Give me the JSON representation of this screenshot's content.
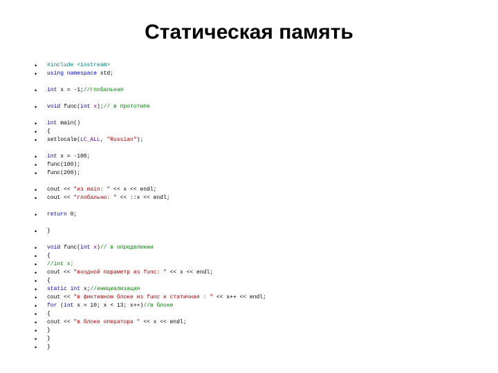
{
  "title": "Статическая память",
  "code": {
    "l1_pp": "#include ",
    "l1_inc": "<iostream>",
    "l2_a": "using namespace ",
    "l2_b": "std;",
    "l3_a": "int ",
    "l3_b": "x = -1;",
    "l3_c": "//глобальная",
    "l4_a": "void ",
    "l4_b": "func(",
    "l4_c": "int ",
    "l4_d": "x",
    "l4_e": ");",
    "l4_f": "// в прототипе",
    "l5_a": "int ",
    "l5_b": "main()",
    "l6": "{",
    "l7_a": "setlocale(",
    "l7_b": "LC_ALL",
    "l7_c": ", ",
    "l7_d": "\"Russian\"",
    "l7_e": ");",
    "l8_a": "int ",
    "l8_b": "x = -100;",
    "l9": "func(100);",
    "l10": "func(200);",
    "l11_a": "cout << ",
    "l11_b": "\"из main: \"",
    "l11_c": " << x << endl;",
    "l12_a": "cout << ",
    "l12_b": "\"глобально: \"",
    "l12_c": " << ::x << endl;",
    "l13_a": "return ",
    "l13_b": "0;",
    "l14": "}",
    "l15_a": "void ",
    "l15_b": "func(",
    "l15_c": "int ",
    "l15_d": "x",
    "l15_e": ")",
    "l15_f": "// в определении",
    "l16": "{",
    "l17": "//int x;",
    "l18_a": "cout << ",
    "l18_b": "\"входной параметр из func: \"",
    "l18_c": " << x << endl;",
    "l19": "{",
    "l20_a": "static int ",
    "l20_b": "x;",
    "l20_c": "//инициализация",
    "l21_a": "cout << ",
    "l21_b": "\"в фиктивном блоке из func и статичная : \"",
    "l21_c": " << x++ << endl;",
    "l22_a": "for ",
    "l22_b": "(",
    "l22_c": "int ",
    "l22_d": "x = 10; x < 13; x++)",
    "l22_e": "//в блоке",
    "l23": "{",
    "l24_a": "cout << ",
    "l24_b": "\"в блоке оператора \"",
    "l24_c": " << x << endl;",
    "l25": "}",
    "l26": "}",
    "l27": "}"
  }
}
